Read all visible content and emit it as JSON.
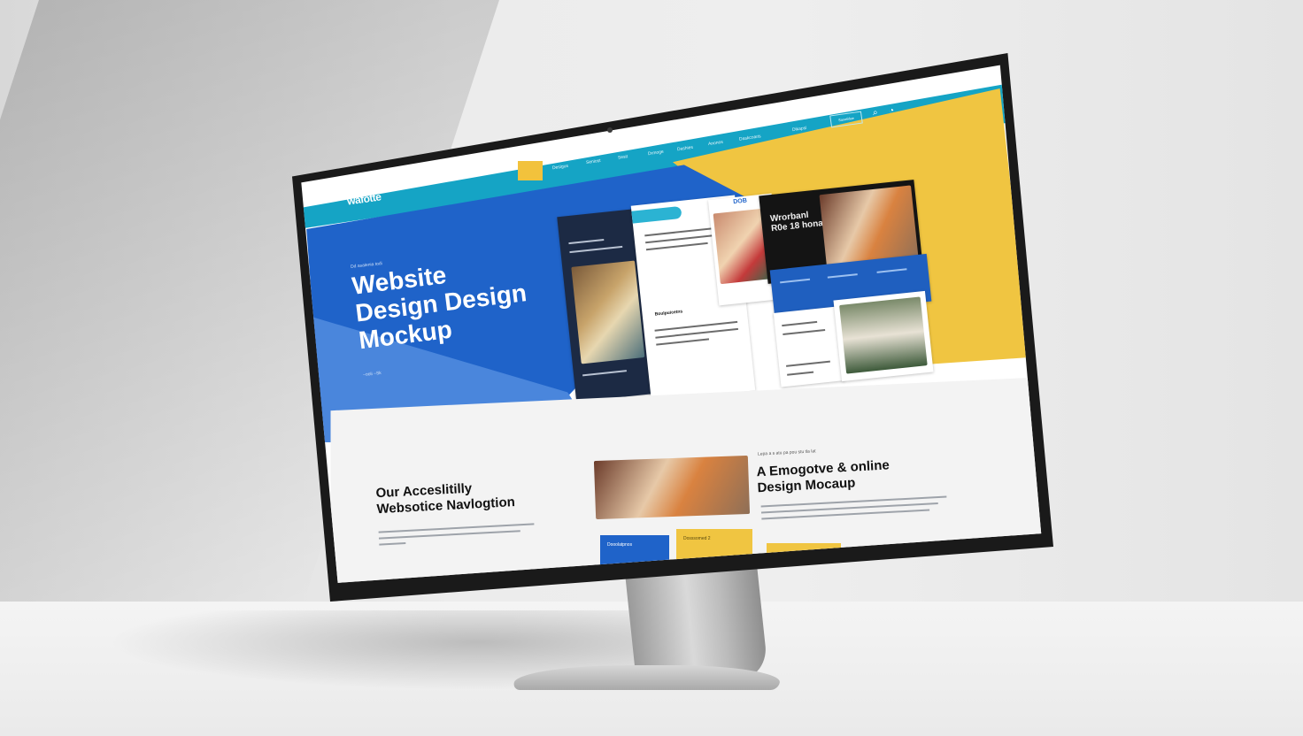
{
  "site": {
    "logo": "wafotte",
    "nav": {
      "items": [
        "Desigus",
        "Seniost",
        "Sesit",
        "Drmoge",
        "Dashies",
        "Anonos",
        "Daskcoaris",
        "Dikapsi"
      ],
      "cta": "Sasotidae",
      "icons": [
        "search-icon",
        "user-icon"
      ]
    },
    "hero": {
      "eyebrow": "Dd asalenia todi",
      "title": "Website\nDesign Design\nMockup",
      "small_link": "~ooli ~Sk"
    },
    "collage": {
      "card_dark_title": "Wrorbanl\nR0e 18 hona",
      "card_tag": "DOB",
      "card_heading": "Boulpuicetns"
    },
    "lower": {
      "left_title": "Our Acceslitilly\nWebsotice Navlogtion",
      "right_eyebrow": "Lepa a s atu pa pou stu tla lat",
      "right_title": "A Emogotve & online\nDesign Mocaup",
      "tile_blue_label": "Dooolatpnos",
      "tile_yellow_label": "Dosssomed 2"
    }
  },
  "colors": {
    "teal": "#15a4c5",
    "blue": "#1f63c9",
    "light_blue": "#4a86dc",
    "yellow": "#f0c541"
  }
}
